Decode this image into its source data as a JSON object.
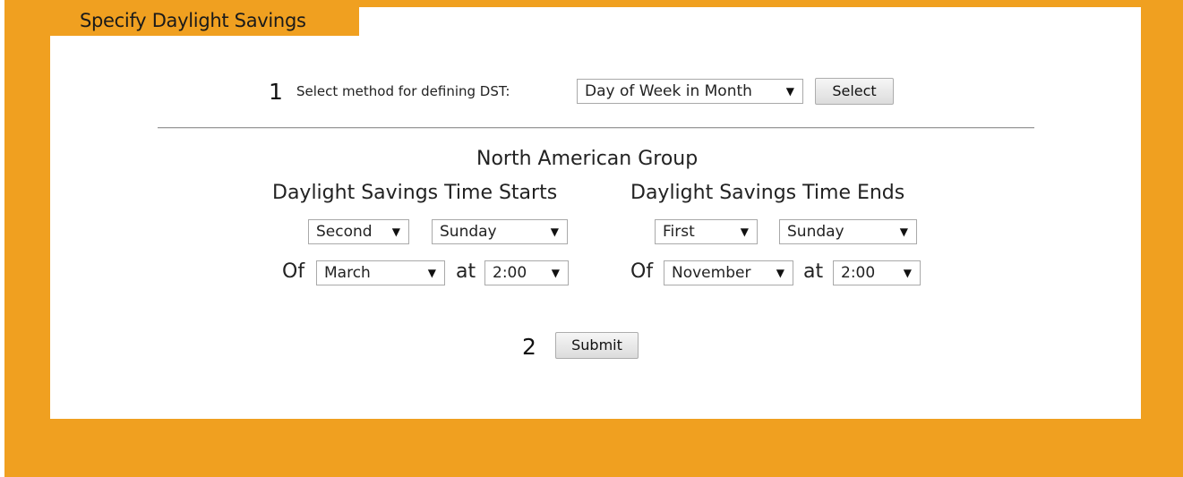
{
  "header": {
    "title": "Specify Daylight Savings"
  },
  "step1": {
    "number": "1",
    "label": "Select method for defining DST:",
    "method_value": "Day of Week in Month",
    "select_button": "Select"
  },
  "group": {
    "title": "North American Group",
    "start": {
      "heading": "Daylight Savings Time Starts",
      "week": "Second",
      "day": "Sunday",
      "of_label": "Of",
      "month": "March",
      "at_label": "at",
      "time": "2:00"
    },
    "end": {
      "heading": "Daylight Savings Time Ends",
      "week": "First",
      "day": "Sunday",
      "of_label": "Of",
      "month": "November",
      "at_label": "at",
      "time": "2:00"
    }
  },
  "step2": {
    "number": "2",
    "submit_button": "Submit"
  },
  "colors": {
    "accent": "#f0a020",
    "panel": "#ffffff"
  },
  "icons": {
    "dropdown": "caret-down-icon"
  }
}
